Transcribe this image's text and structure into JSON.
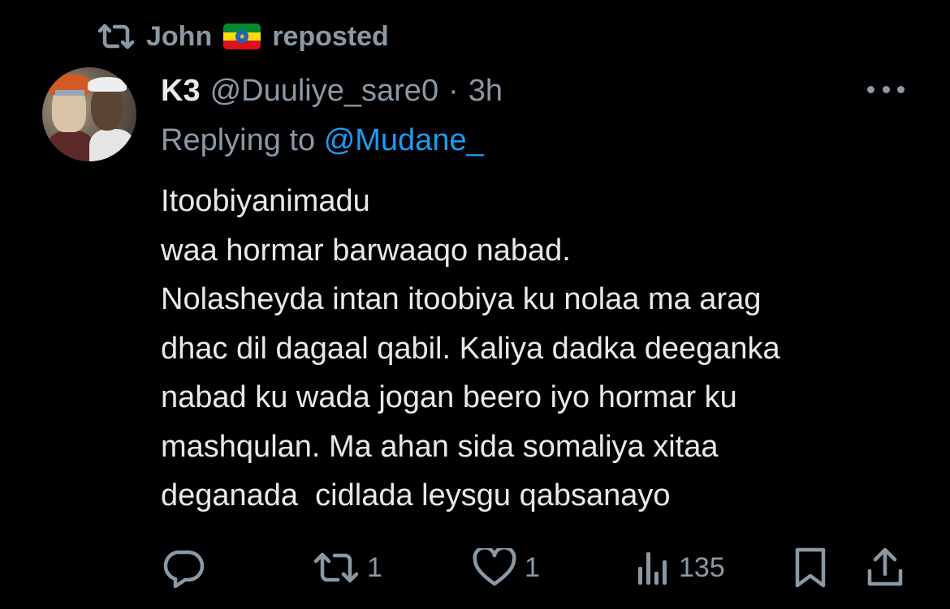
{
  "repost": {
    "icon": "repost-icon",
    "user": "John",
    "flag": "ethiopia-flag-icon",
    "label": "reposted"
  },
  "tweet": {
    "author": {
      "display_name": "K3",
      "handle": "@Duuliye_sare0",
      "separator": "·",
      "time": "3h",
      "avatar": "avatar-image"
    },
    "reply": {
      "prefix": "Replying to",
      "mention": "@Mudane_"
    },
    "text_lines": [
      "Itoobiyanimadu",
      "waa hormar barwaaqo nabad.",
      "Nolasheyda intan itoobiya ku nolaa ma arag",
      "dhac dil dagaal qabil. Kaliya dadka deeganka",
      "nabad ku wada jogan beero iyo hormar ku",
      "mashqulan. Ma ahan sida somaliya xitaa",
      "deganada  cidlada leysgu qabsanayo"
    ]
  },
  "actions": {
    "reply": {
      "icon": "reply-icon"
    },
    "repost": {
      "icon": "repost-icon",
      "count": "1"
    },
    "like": {
      "icon": "heart-icon",
      "count": "1"
    },
    "views": {
      "icon": "views-icon",
      "count": "135"
    },
    "bookmark": {
      "icon": "bookmark-icon"
    },
    "share": {
      "icon": "share-icon"
    }
  },
  "colors": {
    "background": "#000000",
    "text": "#e7e9ea",
    "secondary": "#8b98a5",
    "accent": "#1d9bf0"
  }
}
